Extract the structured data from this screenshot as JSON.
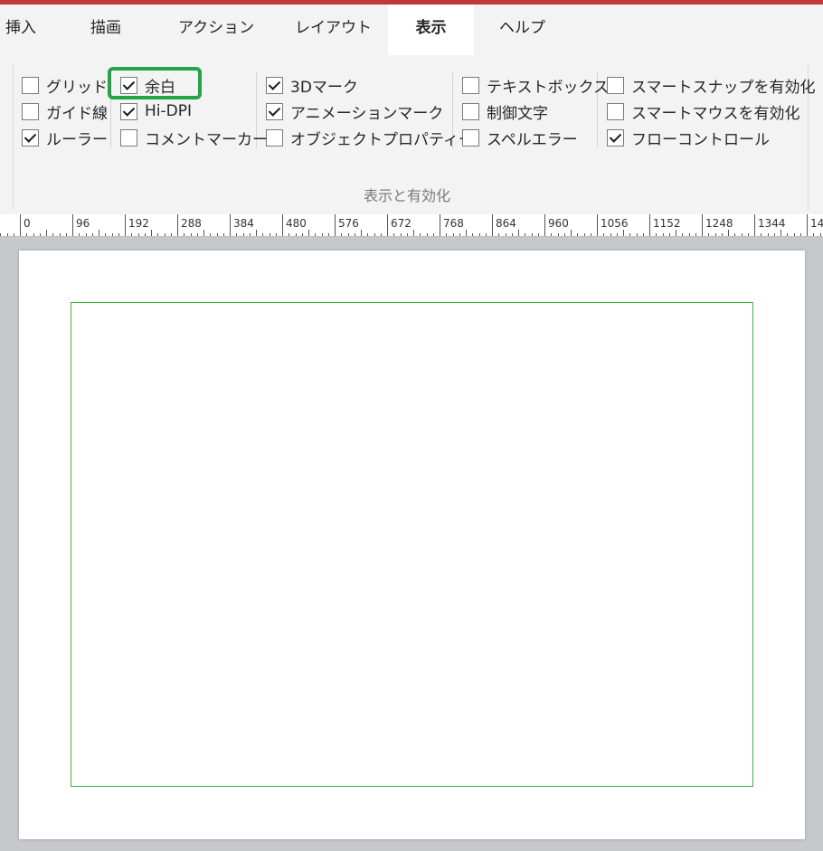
{
  "tabs": [
    {
      "label": "挿入",
      "active": false
    },
    {
      "label": "描画",
      "active": false
    },
    {
      "label": "アクション",
      "active": false
    },
    {
      "label": "レイアウト",
      "active": false
    },
    {
      "label": "表示",
      "active": true
    },
    {
      "label": "ヘルプ",
      "active": false
    }
  ],
  "ribbon": {
    "group_label": "表示と有効化",
    "checkboxes": [
      {
        "label": "グリッド",
        "checked": false
      },
      {
        "label": "ガイド線",
        "checked": false
      },
      {
        "label": "ルーラー",
        "checked": true
      },
      {
        "label": "余白",
        "checked": true
      },
      {
        "label": "Hi-DPI",
        "checked": true
      },
      {
        "label": "コメントマーカー",
        "checked": false
      },
      {
        "label": "3Dマーク",
        "checked": true
      },
      {
        "label": "アニメーションマーク",
        "checked": true
      },
      {
        "label": "オブジェクトプロパティー",
        "checked": false
      },
      {
        "label": "テキストボックス",
        "checked": false
      },
      {
        "label": "制御文字",
        "checked": false
      },
      {
        "label": "スペルエラー",
        "checked": false
      },
      {
        "label": "スマートスナップを有効化",
        "checked": false
      },
      {
        "label": "スマートマウスを有効化",
        "checked": false
      },
      {
        "label": "フローコントロール",
        "checked": true
      }
    ]
  },
  "ruler": {
    "labels": [
      "0",
      "96",
      "192",
      "288",
      "384",
      "480",
      "576",
      "672",
      "768",
      "864",
      "960",
      "1056",
      "1152",
      "1248",
      "1344",
      "14"
    ]
  },
  "colors": {
    "accent_bar": "#c0373c",
    "highlight": "#22a447",
    "margin_line": "#3cb43c"
  }
}
